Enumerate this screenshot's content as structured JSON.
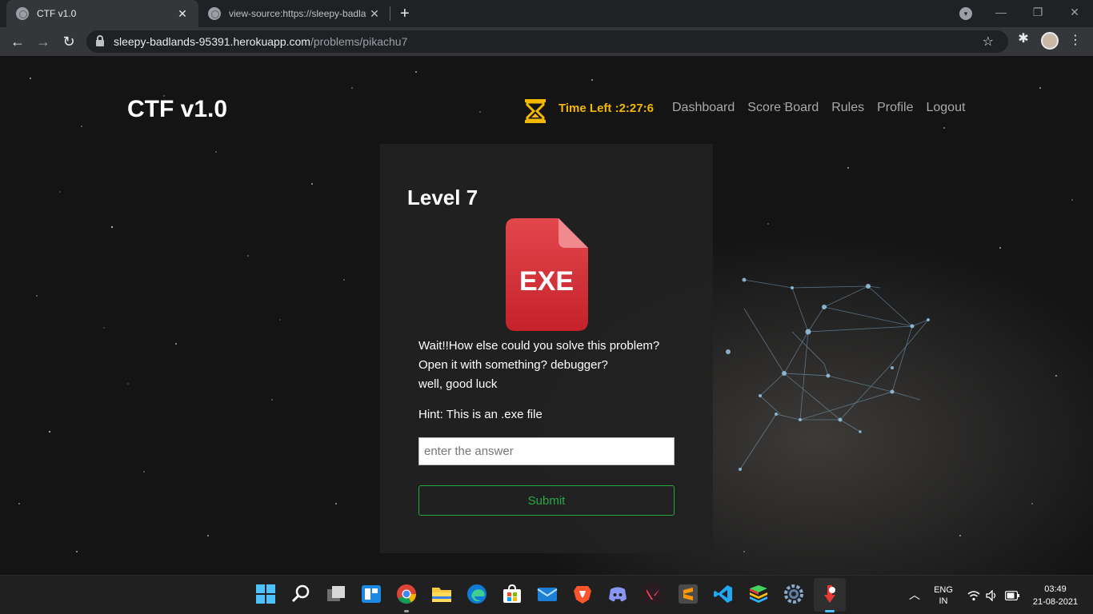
{
  "browser": {
    "tabs": [
      {
        "title": "CTF v1.0",
        "close": "✕"
      },
      {
        "title": "view-source:https://sleepy-badla",
        "close": "✕"
      }
    ],
    "new_tab": "+",
    "url_host": "sleepy-badlands-95391.herokuapp.com",
    "url_path": "/problems/pikachu7"
  },
  "site": {
    "brand": "CTF v1.0",
    "timer": "Time Left :2:27:6",
    "nav": [
      "Dashboard",
      "Score Board",
      "Rules",
      "Profile",
      "Logout"
    ]
  },
  "problem": {
    "level": "Level 7",
    "icon_text": "EXE",
    "desc_lines": [
      "Wait!!How else could you solve this problem?",
      "Open it with something? debugger?",
      "well, good luck"
    ],
    "hint": "Hint: This is an .exe file",
    "answer_placeholder": "enter the answer",
    "submit": "Submit"
  },
  "taskbar": {
    "apps": [
      "windows-start-icon",
      "search-icon",
      "task-view-icon",
      "widgets-icon",
      "chrome-icon",
      "file-explorer-icon",
      "edge-icon",
      "store-icon",
      "mail-icon",
      "brave-icon",
      "discord-icon",
      "valorant-icon",
      "sublime-text-icon",
      "vscode-icon",
      "bluestacks-icon",
      "settings-icon",
      "app-icon"
    ],
    "lang_top": "ENG",
    "lang_bottom": "IN",
    "time": "03:49",
    "date": "21-08-2021"
  },
  "colors": {
    "accent_timer": "#f5b800",
    "submit_green": "#28a745",
    "exe_red": "#d42e36"
  }
}
